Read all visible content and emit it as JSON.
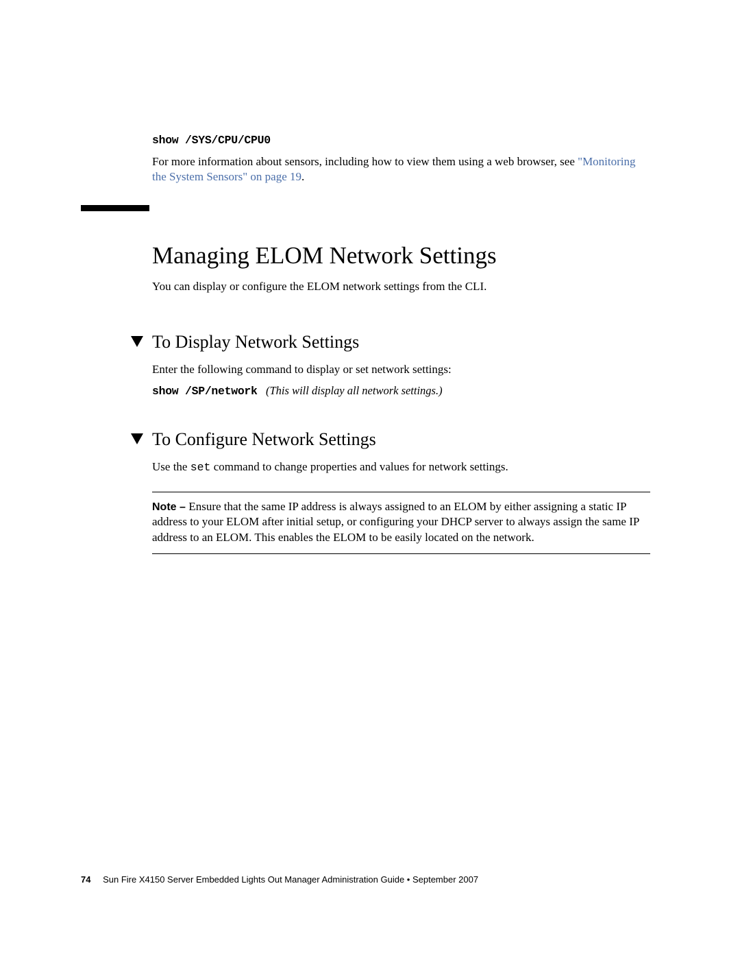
{
  "top_command": "show /SYS/CPU/CPU0",
  "top_para_pre": "For more information about sensors, including how to view them using a web browser, see ",
  "top_link": "\"Monitoring the System Sensors\" on page 19",
  "top_para_post": ".",
  "section_title": "Managing ELOM Network Settings",
  "section_intro": "You can display or configure the ELOM network settings from the CLI.",
  "sub1": {
    "heading": "To Display Network Settings",
    "para": "Enter the following command to display or set network settings:",
    "cmd": "show /SP/network",
    "cmd_note": "(This will display all network settings.)"
  },
  "sub2": {
    "heading": "To Configure Network Settings",
    "para_pre": "Use the ",
    "para_code": "set",
    "para_post": " command to change properties and values for network settings.",
    "note_label": "Note – ",
    "note_body": "Ensure that the same IP address is always assigned to an ELOM by either assigning a static IP address to your ELOM after initial setup, or configuring your DHCP server to always assign the same IP address to an ELOM. This enables the ELOM to be easily located on the network."
  },
  "footer": {
    "page_number": "74",
    "doc_title": "Sun Fire X4150 Server Embedded Lights Out Manager Administration Guide • September 2007"
  }
}
